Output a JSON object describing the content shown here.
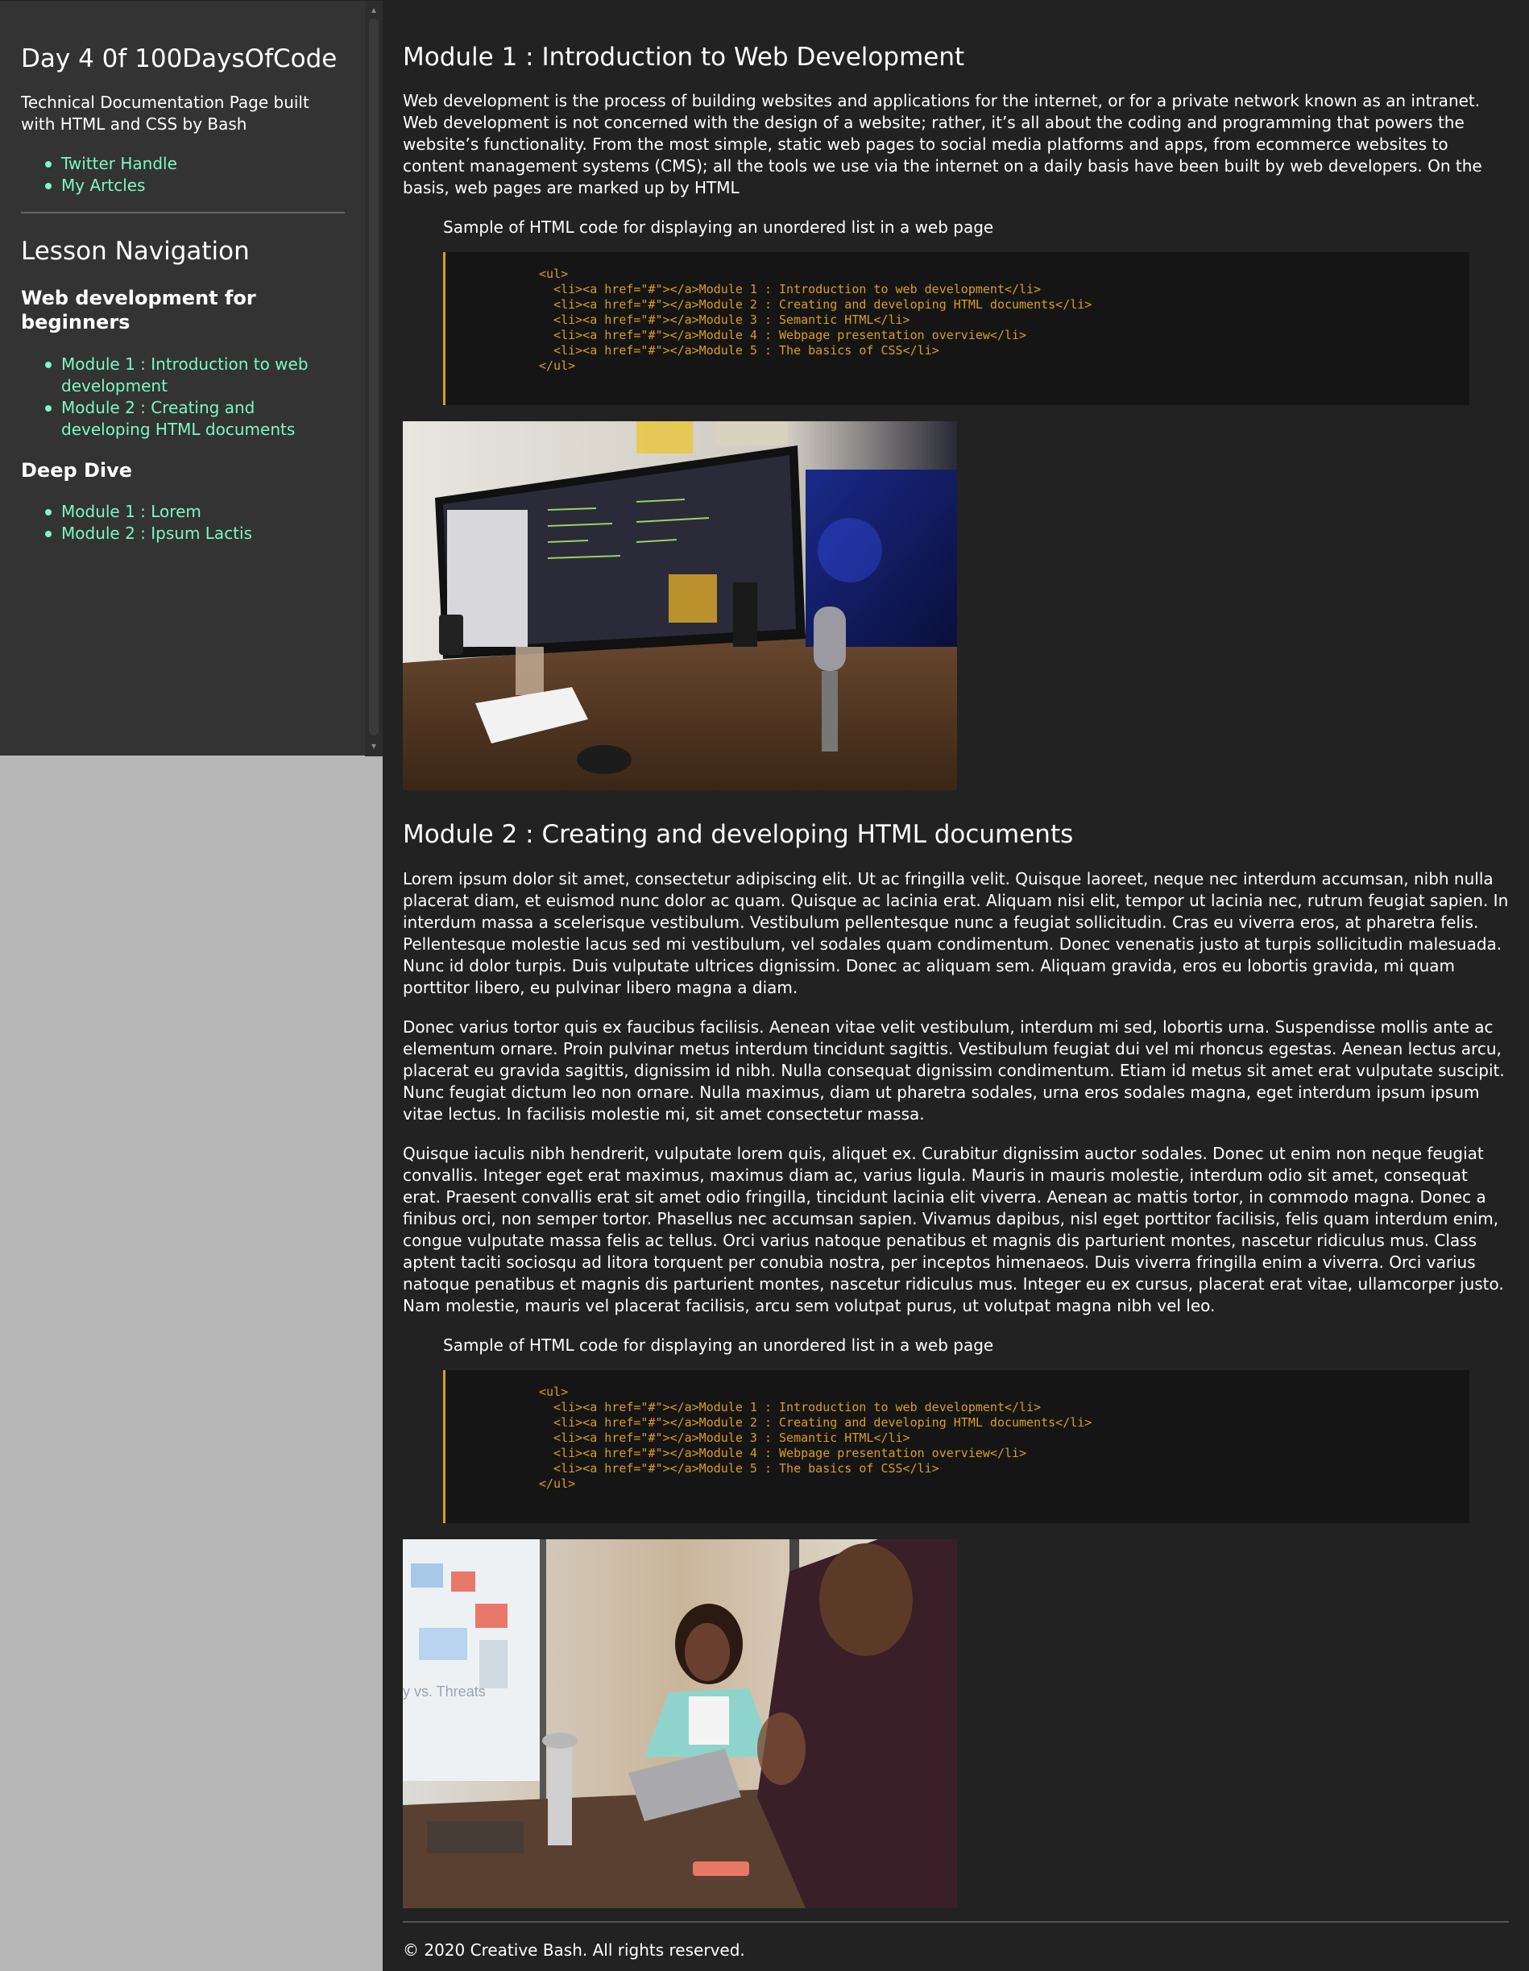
{
  "sidebar": {
    "title": "Day 4 0f 100DaysOfCode",
    "description": "Technical Documentation Page built with HTML and CSS by Bash",
    "links": [
      {
        "label": "Twitter Handle"
      },
      {
        "label": "My Artcles"
      }
    ],
    "nav_heading": "Lesson Navigation",
    "sections": [
      {
        "heading": "Web development for beginners",
        "items": [
          {
            "label": "Module 1 : Introduction to web development"
          },
          {
            "label": "Module 2 : Creating and developing HTML documents"
          }
        ]
      },
      {
        "heading": "Deep Dive",
        "items": [
          {
            "label": "Module 1 : Lorem"
          },
          {
            "label": "Module 2 : Ipsum Lactis"
          }
        ]
      }
    ]
  },
  "main": {
    "module1": {
      "title": "Module 1 : Introduction to Web Development",
      "paragraph": "Web development is the process of building websites and applications for the internet, or for a private network known as an intranet. Web development is not concerned with the design of a website; rather, it’s all about the coding and programming that powers the website’s functionality. From the most simple, static web pages to social media platforms and apps, from ecommerce websites to content management systems (CMS); all the tools we use via the internet on a daily basis have been built by web developers. On the basis, web pages are marked up by HTML",
      "sample_caption": "Sample of HTML code for displaying an unordered list in a web page",
      "code": "<ul>\n  <li><a href=\"#\"></a>Module 1 : Introduction to web development</li>\n  <li><a href=\"#\"></a>Module 2 : Creating and developing HTML documents</li>\n  <li><a href=\"#\"></a>Module 3 : Semantic HTML</li>\n  <li><a href=\"#\"></a>Module 4 : Webpage presentation overview</li>\n  <li><a href=\"#\"></a>Module 5 : The basics of CSS</li>\n</ul>"
    },
    "module2": {
      "title": "Module 2 : Creating and developing HTML documents",
      "paragraphs": [
        "Lorem ipsum dolor sit amet, consectetur adipiscing elit. Ut ac fringilla velit. Quisque laoreet, neque nec interdum accumsan, nibh nulla placerat diam, et euismod nunc dolor ac quam. Quisque ac lacinia erat. Aliquam nisi elit, tempor ut lacinia nec, rutrum feugiat sapien. In interdum massa a scelerisque vestibulum. Vestibulum pellentesque nunc a feugiat sollicitudin. Cras eu viverra eros, at pharetra felis. Pellentesque molestie lacus sed mi vestibulum, vel sodales quam condimentum. Donec venenatis justo at turpis sollicitudin malesuada. Nunc id dolor turpis. Duis vulputate ultrices dignissim. Donec ac aliquam sem. Aliquam gravida, eros eu lobortis gravida, mi quam porttitor libero, eu pulvinar libero magna a diam.",
        "Donec varius tortor quis ex faucibus facilisis. Aenean vitae velit vestibulum, interdum mi sed, lobortis urna. Suspendisse mollis ante ac elementum ornare. Proin pulvinar metus interdum tincidunt sagittis. Vestibulum feugiat dui vel mi rhoncus egestas. Aenean lectus arcu, placerat eu gravida sagittis, dignissim id nibh. Nulla consequat dignissim condimentum. Etiam id metus sit amet erat vulputate suscipit. Nunc feugiat dictum leo non ornare. Nulla maximus, diam ut pharetra sodales, urna eros sodales magna, eget interdum ipsum ipsum vitae lectus. In facilisis molestie mi, sit amet consectetur massa.",
        "Quisque iaculis nibh hendrerit, vulputate lorem quis, aliquet ex. Curabitur dignissim auctor sodales. Donec ut enim non neque feugiat convallis. Integer eget erat maximus, maximus diam ac, varius ligula. Mauris in mauris molestie, interdum odio sit amet, consequat erat. Praesent convallis erat sit amet odio fringilla, tincidunt lacinia elit viverra. Aenean ac mattis tortor, in commodo magna. Donec a finibus orci, non semper tortor. Phasellus nec accumsan sapien. Vivamus dapibus, nisl eget porttitor facilisis, felis quam interdum enim, congue vulputate massa felis ac tellus. Orci varius natoque penatibus et magnis dis parturient montes, nascetur ridiculus mus. Class aptent taciti sociosqu ad litora torquent per conubia nostra, per inceptos himenaeos. Duis viverra fringilla enim a viverra. Orci varius natoque penatibus et magnis dis parturient montes, nascetur ridiculus mus. Integer eu ex cursus, placerat erat vitae, ullamcorper justo. Nam molestie, mauris vel placerat facilisis, arcu sem volutpat purus, ut volutpat magna nibh vel leo."
      ],
      "sample_caption": "Sample of HTML code for displaying an unordered list in a web page",
      "code": "<ul>\n  <li><a href=\"#\"></a>Module 1 : Introduction to web development</li>\n  <li><a href=\"#\"></a>Module 2 : Creating and developing HTML documents</li>\n  <li><a href=\"#\"></a>Module 3 : Semantic HTML</li>\n  <li><a href=\"#\"></a>Module 4 : Webpage presentation overview</li>\n  <li><a href=\"#\"></a>Module 5 : The basics of CSS</li>\n</ul>",
      "whiteboard_text": "y vs. Threats"
    },
    "footer": "© 2020 Creative Bash. All rights reserved."
  },
  "colors": {
    "sidebar_bg": "#333333",
    "main_bg": "#222222",
    "link": "#7cf7c6",
    "code_text": "#d99d22",
    "code_border": "#d99d22",
    "page_bg": "#b7b7b7"
  }
}
